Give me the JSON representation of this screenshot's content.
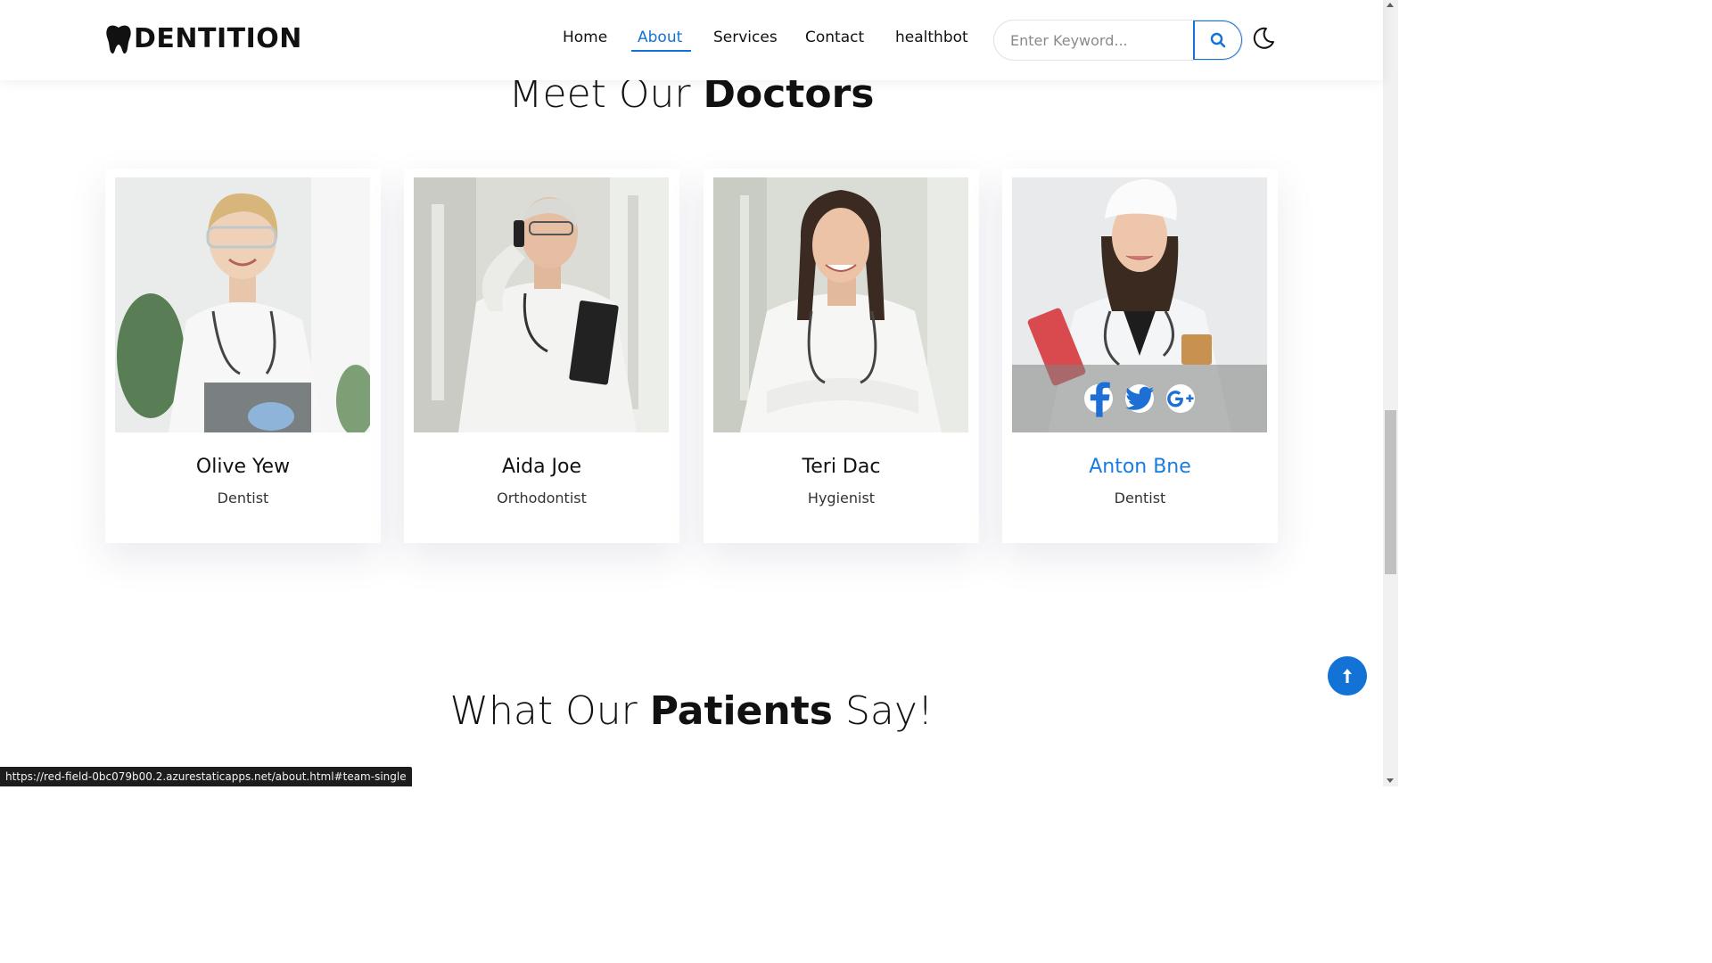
{
  "header": {
    "logo_text": "DENTITION",
    "logo_icon": "tooth-icon",
    "nav": [
      {
        "label": "Home",
        "active": false
      },
      {
        "label": "About",
        "active": true
      },
      {
        "label": "Services",
        "active": false
      },
      {
        "label": "Contact",
        "active": false
      },
      {
        "label": "healthbot",
        "active": false
      }
    ],
    "search": {
      "placeholder": "Enter Keyword...",
      "value": "",
      "button_icon": "search-icon"
    },
    "theme_toggle_icon": "moon-icon"
  },
  "doctors_section": {
    "title_light": "Meet Our ",
    "title_bold": "Doctors",
    "cards": [
      {
        "name": "Olive Yew",
        "role": "Dentist"
      },
      {
        "name": "Aida Joe",
        "role": "Orthodontist"
      },
      {
        "name": "Teri Dac",
        "role": "Hygienist"
      },
      {
        "name": "Anton Bne",
        "role": "Dentist",
        "hovered": true,
        "social": [
          "facebook-icon",
          "twitter-icon",
          "google-plus-icon"
        ]
      }
    ]
  },
  "patients_section": {
    "title_light_1": "What Our ",
    "title_bold": "Patients",
    "title_light_2": " Say!"
  },
  "back_to_top_icon": "arrow-up-icon",
  "status_bar": {
    "url": "https://red-field-0bc079b00.2.azurestaticapps.net/about.html#team-single"
  },
  "colors": {
    "accent": "#1272d6",
    "hover_name": "#1a7be0"
  }
}
